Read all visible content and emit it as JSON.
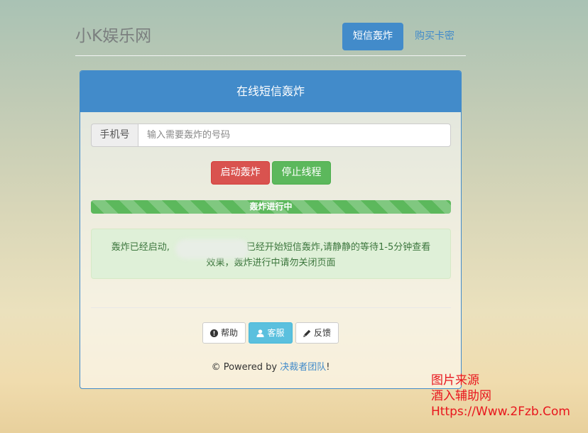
{
  "header": {
    "brand": "小K娱乐网",
    "nav_active": "短信轰炸",
    "nav_link": "购买卡密"
  },
  "panel": {
    "title": "在线短信轰炸",
    "phone_label": "手机号",
    "phone_placeholder": "输入需要轰炸的号码",
    "phone_value": "",
    "start_button": "启动轰炸",
    "stop_button": "停止线程",
    "progress_label": "轰炸进行中",
    "progress_fraction": 1.0,
    "alert_line1_before": "轰炸已经启动,",
    "alert_line1_after": "已经开始短信轰炸,请静静的等待1-5分钟查看",
    "alert_line2": "效果，轰炸进行中请勿关闭页面"
  },
  "footer": {
    "help": "帮助",
    "service": "客服",
    "feedback": "反馈",
    "powered_prefix": "© Powered by ",
    "team": "决裁者团队",
    "powered_suffix": "!"
  },
  "watermark": {
    "line1": "图片来源",
    "line2": "酒入辅助网",
    "line3": "Https://Www.2Fzb.Com"
  },
  "colors": {
    "primary": "#428bca",
    "danger": "#d9534f",
    "success": "#5cb85c",
    "info": "#5bc0de",
    "alert_bg": "#dff0d8",
    "watermark": "#e8161d"
  }
}
